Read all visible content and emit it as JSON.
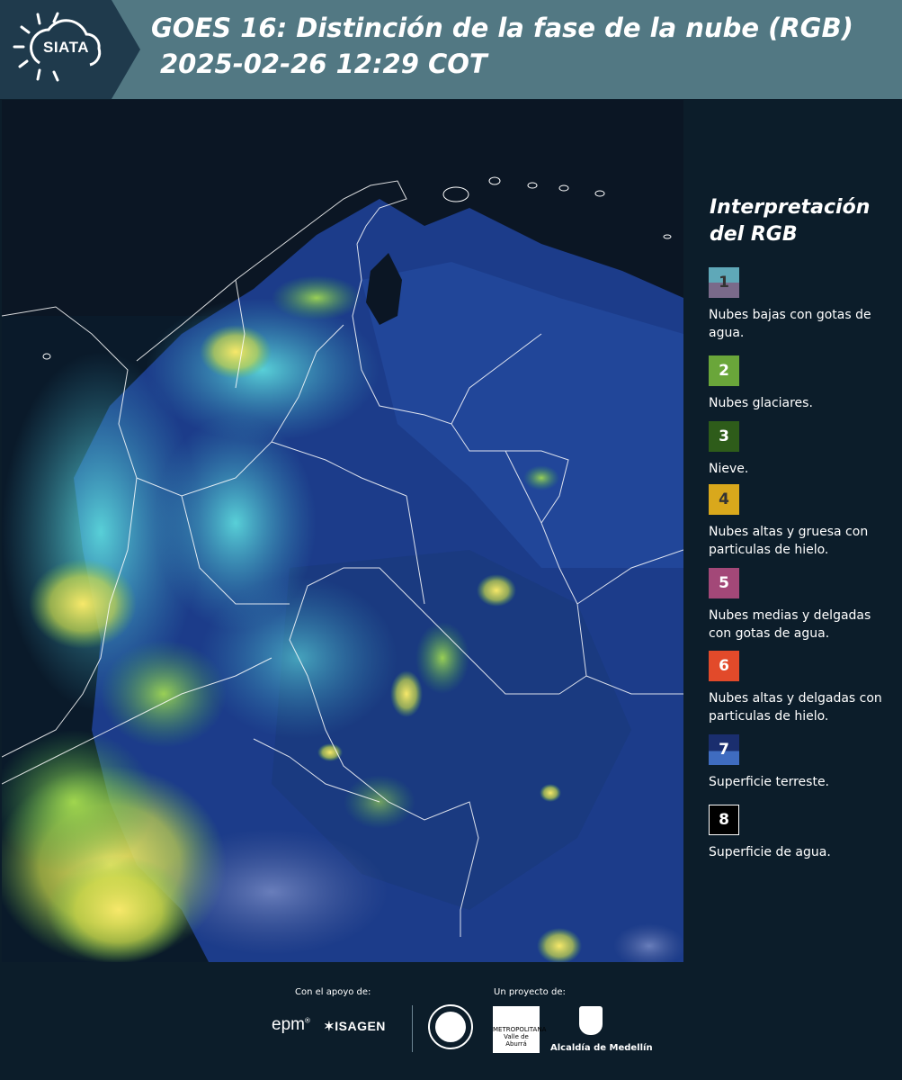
{
  "header": {
    "logo_text": "SIATA",
    "title": "GOES 16: Distinción de la fase de la nube (RGB)",
    "subtitle": "2025-02-26 12:29 COT"
  },
  "legend": {
    "title_line1": "Interpretación",
    "title_line2": "del RGB",
    "items": [
      {
        "number": "1",
        "label": "Nubes bajas con gotas de agua.",
        "color_top": "#5fa8b8",
        "color_bottom": "#7a6a8a",
        "text_color": "#333333"
      },
      {
        "number": "2",
        "label": "Nubes glaciares.",
        "color_top": "#6aa63a",
        "color_bottom": "#6aa63a",
        "text_color": "#ffffff"
      },
      {
        "number": "3",
        "label": "Nieve.",
        "color_top": "#2e5c1a",
        "color_bottom": "#2e5c1a",
        "text_color": "#ffffff"
      },
      {
        "number": "4",
        "label": "Nubes altas y gruesa con particulas de hielo.",
        "color_top": "#d9a81c",
        "color_bottom": "#d9a81c",
        "text_color": "#333333"
      },
      {
        "number": "5",
        "label": "Nubes medias y delgadas con gotas de agua.",
        "color_top": "#a34878",
        "color_bottom": "#a34878",
        "text_color": "#ffffff"
      },
      {
        "number": "6",
        "label": "Nubes altas y delgadas con particulas de hielo.",
        "color_top": "#e24a2a",
        "color_bottom": "#e24a2a",
        "text_color": "#ffffff"
      },
      {
        "number": "7",
        "label": "Superficie terreste.",
        "color_top": "#1a2e6e",
        "color_bottom": "#3f6cc0",
        "text_color": "#ffffff"
      },
      {
        "number": "8",
        "label": "Superficie de agua.",
        "color_top": "#000000",
        "color_bottom": "#000000",
        "text_color": "#ffffff"
      }
    ]
  },
  "footer": {
    "support_caption": "Con el apoyo de:",
    "project_caption": "Un proyecto de:",
    "sponsor1": "epm",
    "sponsor2": "ISAGEN",
    "area_logo_text": "METROPOLITANA Valle de Aburrá",
    "alcaldia": "Alcaldía de Medellín"
  }
}
